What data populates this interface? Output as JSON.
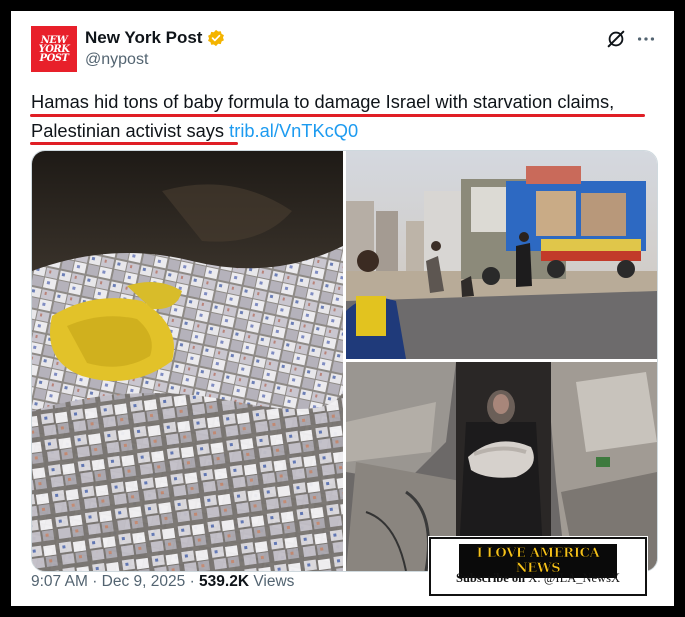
{
  "author": {
    "display_name": "New York Post",
    "handle": "@nypost",
    "avatar_text": "NEW\nYORK\nPOST",
    "verified": true,
    "badge_color": "#f4b400"
  },
  "post": {
    "text_line1": "Hamas hid tons of baby formula to damage Israel with starvation claims,",
    "text_line2": "Palestinian activist says",
    "link": "trib.al/VnTKcQ0"
  },
  "media": [
    {
      "name": "baby-formula-pile-image"
    },
    {
      "name": "aid-trucks-image"
    },
    {
      "name": "woman-holding-child-rubble-image"
    }
  ],
  "watermark": {
    "title": "I LOVE AMERICA NEWS",
    "subtitle_prefix": "Subscribe on",
    "subtitle_handle": "X: @ILA_NewsX"
  },
  "footer": {
    "time": "9:07 AM",
    "date": "Dec 9, 2025",
    "views_count": "539.2K",
    "views_label": "Views"
  },
  "colors": {
    "link": "#1d9bf0",
    "underline": "#e01e25",
    "avatar_bg": "#e8202a",
    "text": "#0f1419",
    "muted": "#536471"
  },
  "icons": [
    "grok-icon",
    "more-icon",
    "verified-badge-icon"
  ]
}
